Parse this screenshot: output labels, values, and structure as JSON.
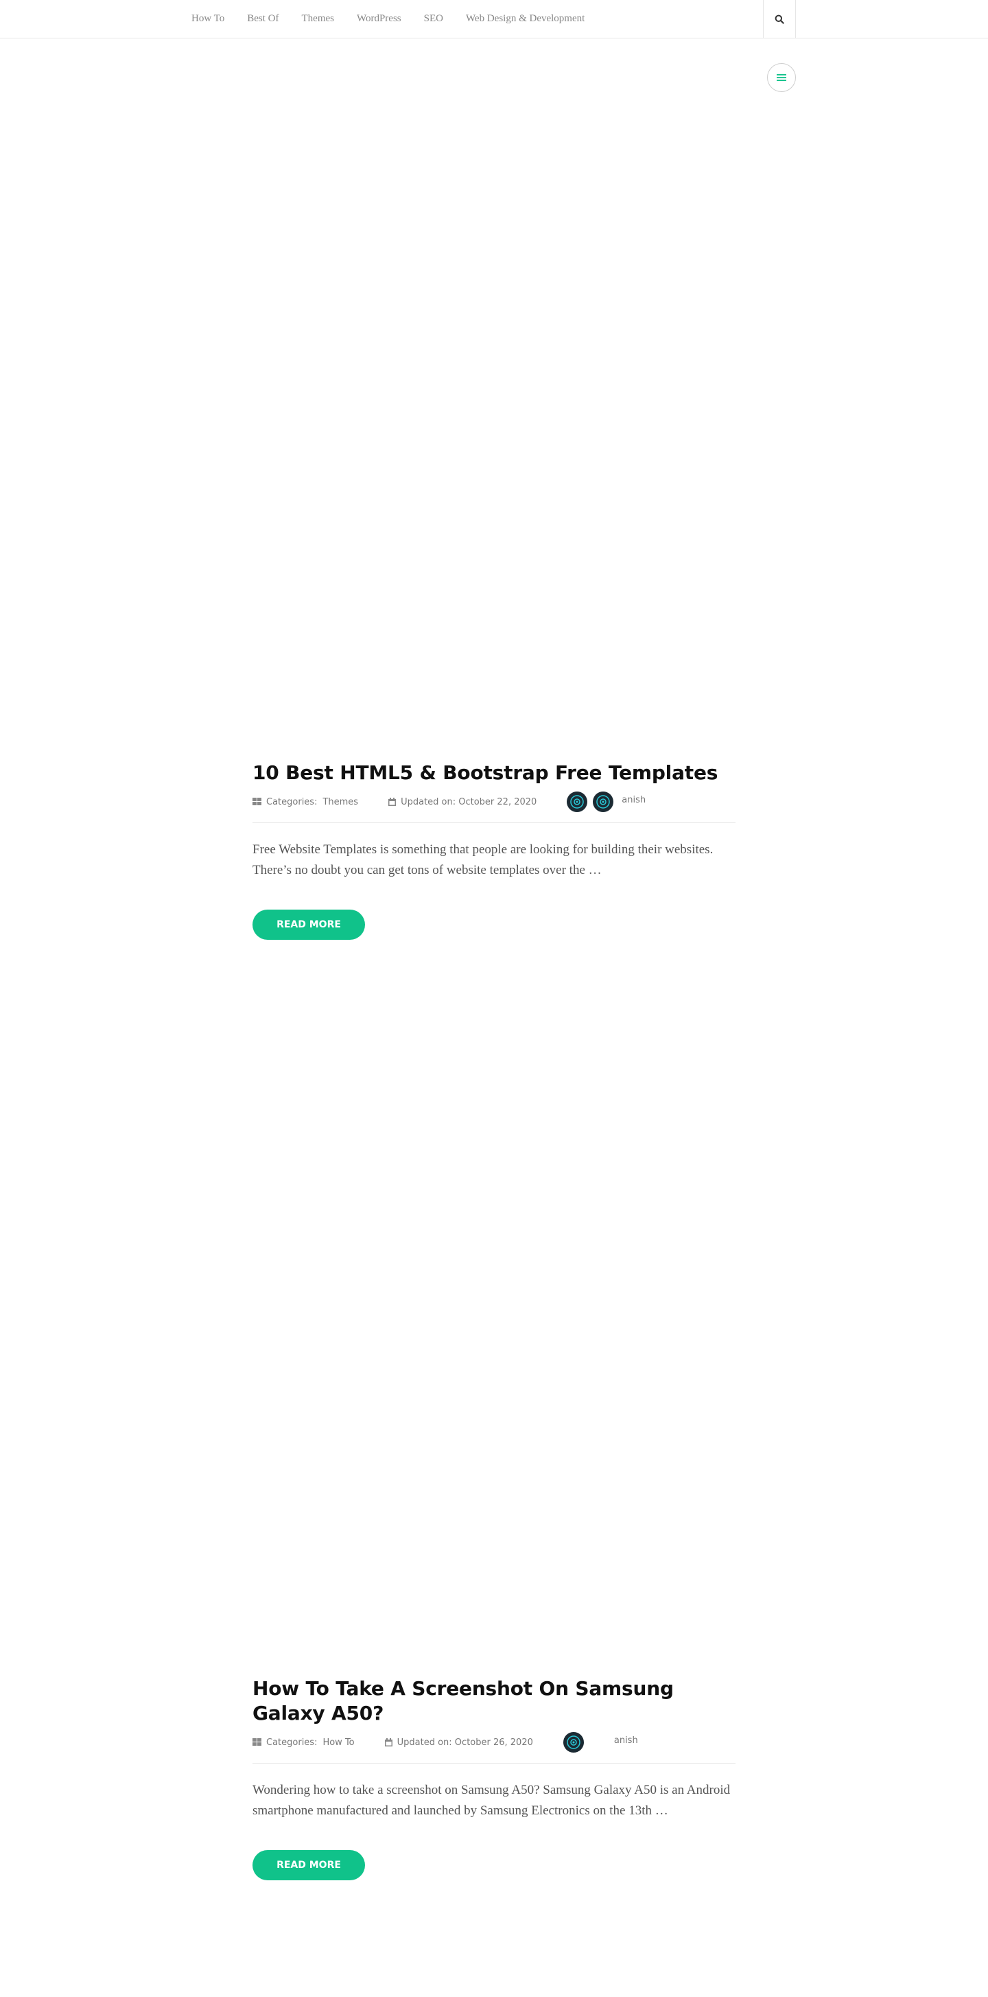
{
  "nav": {
    "items": [
      {
        "label": "How To"
      },
      {
        "label": "Best Of"
      },
      {
        "label": "Themes"
      },
      {
        "label": "WordPress"
      },
      {
        "label": "SEO"
      },
      {
        "label": "Web Design & Development"
      }
    ],
    "search_icon": "search-icon",
    "menu_icon": "hamburger-menu-icon"
  },
  "colors": {
    "accent": "#10c28a",
    "title": "#111111",
    "meta": "#777777"
  },
  "posts": [
    {
      "title": "10 Best HTML5 & Bootstrap Free Templates",
      "categories_label": "Categories:",
      "category": "Themes",
      "updated": "Updated on: October 22, 2020",
      "author": "anish",
      "excerpt": "Free Website Templates is something that people are looking for building their websites. There’s no doubt you can get tons of website templates over the …",
      "read_more": "READ MORE"
    },
    {
      "title": "How To Take A Screenshot On Samsung Galaxy A50?",
      "categories_label": "Categories:",
      "category": "How To",
      "updated": "Updated on: October 26, 2020",
      "author": "anish",
      "excerpt": "Wondering how to take a screenshot on Samsung A50? Samsung Galaxy A50 is an Android smartphone manufactured and launched by Samsung Electronics on the 13th …",
      "read_more": "READ MORE"
    }
  ]
}
